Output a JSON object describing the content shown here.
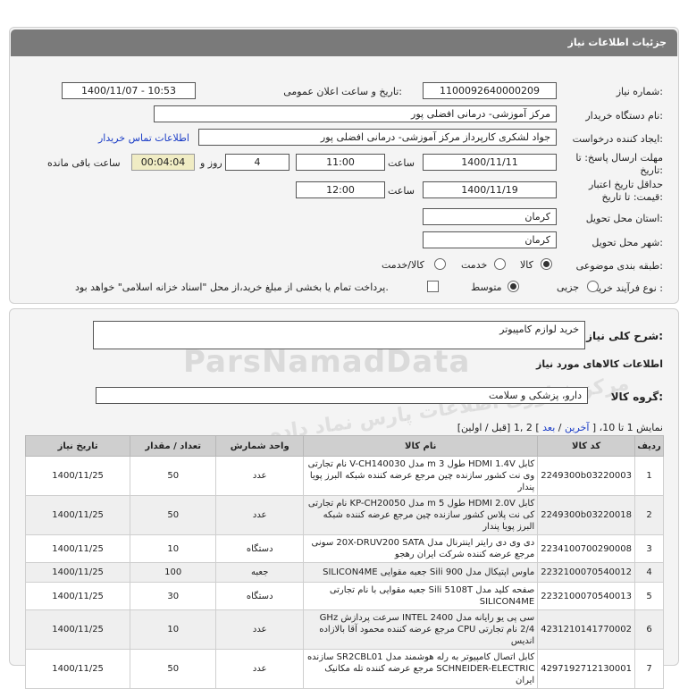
{
  "header": {
    "title": "جزئیات اطلاعات نیاز"
  },
  "form": {
    "need_number_label": "شماره نیاز:",
    "need_number": "1100092640000209",
    "announce_label": "تاریخ و ساعت اعلان عمومی:",
    "announce_value": "1400/11/07 - 10:53",
    "buyer_org_label": "نام دستگاه خریدار:",
    "buyer_org": "مرکز آموزشی- درمانی افضلی پور",
    "creator_label": "ایجاد کننده درخواست:",
    "creator": "جواد  لشکری  کارپرداز مرکز آموزشی- درمانی افضلی پور",
    "contact_link": "اطلاعات تماس خریدار",
    "deadline_label_1": "مهلت ارسال پاسخ: تا",
    "deadline_label_2": "تاریخ:",
    "deadline_date": "1400/11/11",
    "time_label": "ساعت",
    "deadline_time": "11:00",
    "days": "4",
    "days_label": "روز و",
    "remaining": "00:04:04",
    "remaining_label": "ساعت باقی مانده",
    "validity_label_1": "حداقل تاریخ اعتبار",
    "validity_label_2": "قیمت: تا تاریخ:",
    "validity_date": "1400/11/19",
    "validity_time": "12:00",
    "province_label": "استان محل تحویل:",
    "province": "کرمان",
    "city_label": "شهر محل تحویل:",
    "city": "کرمان",
    "category_label": "طبقه بندی موضوعی:",
    "category_options": [
      "کالا",
      "خدمت",
      "کالا/خدمت"
    ],
    "process_label": "نوع فرآیند خرید :",
    "process_options": [
      "جزیی",
      "متوسط"
    ],
    "payment_note": "پرداخت تمام یا بخشی از مبلغ خرید،از محل \"اسناد خزانه اسلامی\" خواهد بود."
  },
  "summary": {
    "desc_label": "شرح کلی نیاز:",
    "desc_value": "خرید لوازم کامپیوتر",
    "goods_info_title": "اطلاعات کالاهای مورد نیاز",
    "goods_group_label": "گروه کالا:",
    "goods_group": "دارو، پزشکی و سلامت",
    "watermark": "ParsNamadData",
    "watermark2": "مرکز فناوری اطلاعات پارس نماد داده",
    "pager": {
      "showing": "نمایش 1 تا 10، [",
      "last": "آخرین",
      "sep1": "/",
      "next": "بعد",
      "pages": "] 2 ,1 [قبل / اولین]"
    }
  },
  "table": {
    "headers": [
      "ردیف",
      "کد کالا",
      "نام کالا",
      "واحد شمارش",
      "تعداد / مقدار",
      "تاریخ نیاز"
    ],
    "rows": [
      [
        "1",
        "2249300b03220003",
        "کابل HDMI 1.4V طول 3 m مدل V-CH140030 نام تجارتی وی نت کشور سازنده چین مرجع عرضه کننده شبکه البرز پویا پندار",
        "عدد",
        "50",
        "1400/11/25"
      ],
      [
        "2",
        "2249300b03220018",
        "کابل HDMI 2.0V طول 5 m مدل KP-CH20050 نام تجارتی کی نت پلاس کشور سازنده چین مرجع عرضه کننده شبکه البرز پویا پندار",
        "عدد",
        "50",
        "1400/11/25"
      ],
      [
        "3",
        "2234100700290008",
        "دی وی دی رایتر اینترنال مدل 20X-DRUV200 SATA سونی مرجع عرضه کننده شرکت ایران رهجو",
        "دستگاه",
        "10",
        "1400/11/25"
      ],
      [
        "4",
        "2232100070540012",
        "ماوس اپتیکال مدل Sili 900 جعبه مقوایی SILICON4ME",
        "جعبه",
        "100",
        "1400/11/25"
      ],
      [
        "5",
        "2232100070540013",
        "صفحه کلید مدل Sili 5108T جعبه مقوایی با نام تجارتی SILICON4ME",
        "دستگاه",
        "30",
        "1400/11/25"
      ],
      [
        "6",
        "4231210141770002",
        "سی پی یو رایانه مدل INTEL 2400 سرعت پردازش GHz 2/4 نام تجارتی CPU مرجع عرضه کننده محمود آقا بالازاده اندیس",
        "عدد",
        "10",
        "1400/11/25"
      ],
      [
        "7",
        "4297192712130001",
        "کابل اتصال کامپیوتر به رله هوشمند مدل SR2CBL01 سازنده SCHNEIDER-ELECTRIC مرجع عرضه کننده تله مکانیک ایران",
        "عدد",
        "50",
        "1400/11/25"
      ]
    ]
  }
}
